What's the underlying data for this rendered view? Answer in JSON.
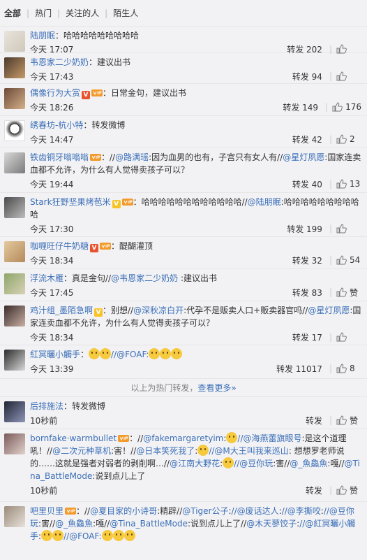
{
  "filters": {
    "all": "全部",
    "hot": "热门",
    "following": "关注的人",
    "strangers": "陌生人"
  },
  "hot_tip": {
    "text": "以上为热门转发，",
    "more": "查看更多»"
  },
  "like_label": "赞",
  "comments": [
    {
      "name": "陆朋眠",
      "text": "：哈哈哈哈哈哈哈哈哈",
      "time": "今天 17:07",
      "repost": "转发 202",
      "likes": ""
    },
    {
      "name": "韦恩家二少奶奶",
      "text": "：建议出书",
      "time": "今天 17:43",
      "repost": "转发 94",
      "likes": ""
    },
    {
      "name": "偶像行为大赏",
      "text": "：日常金句，建议出书",
      "time": "今天 18:26",
      "repost": "转发 149",
      "likes": "176"
    },
    {
      "name": "绣春坊-杭小特",
      "text": "：转发微博",
      "time": "今天 14:47",
      "repost": "转发 42",
      "likes": "2"
    },
    {
      "name": "铁齿铜牙嗡嗡嗡",
      "text_pre": "：//",
      "mention1": "@路满瑶",
      "text_mid": ":因为血男的也有，子宫只有女人有//",
      "mention2": "@星灯夙愿",
      "text_post": ":国家连卖血都不允许，为什么有人觉得卖孩子可以？",
      "time": "今天 19:44",
      "repost": "转发 40",
      "likes": "13"
    },
    {
      "name": "Stark狂野坚果烤苞米",
      "text_pre": "：哈哈哈哈哈哈哈哈哈哈哈哈//",
      "mention1": "@陆朋眠",
      "text_post": ":哈哈哈哈哈哈哈哈哈哈",
      "time": "今天 17:30",
      "repost": "转发 199",
      "likes": ""
    },
    {
      "name": "咖喱旺仔牛奶糖",
      "text": "：醍醐灌顶",
      "time": "今天 18:34",
      "repost": "转发 32",
      "likes": "54"
    },
    {
      "name": "浮流木雁",
      "text_pre": "：真是金句//",
      "mention1": "@韦恩家二少奶奶",
      "text_post": " :建议出书",
      "time": "今天 17:45",
      "repost": "转发 83",
      "likes": "赞"
    },
    {
      "name": "鸡汁组_墨陌急啊",
      "text_pre": "：别想//",
      "mention1": "@深秋凉白开",
      "text_mid": ":代孕不是贩卖人口+贩卖器官吗//",
      "mention2": "@星灯夙愿",
      "text_post": ":国家连卖血都不允许，为什么有人觉得卖孩子可以？",
      "time": "今天 18:34",
      "repost": "转发 17",
      "likes": ""
    },
    {
      "name": "紅冥曬小觸手",
      "text_pre": "：",
      "mention1": "//@FOAF:",
      "time": "今天 13:39",
      "repost": "转发 11017",
      "likes": "8"
    },
    {
      "name": "后排施法",
      "text": "：转发微博",
      "time": "10秒前",
      "repost": "转发",
      "likes": ""
    },
    {
      "name": "bornfake·warmbullet",
      "text_a": "：//",
      "m_a": "@fakemargaretyim",
      "text_b": ":",
      "m_b": "//@海燕蕾旗眼号",
      "text_c": ":是这个道理吼！//",
      "m_c": "@二次元种草机",
      "text_d": ":害！//",
      "m_d": "@日本笑死我了",
      "text_e": ":",
      "m_e": "//@M大王叫我来巡山",
      "text_f": ": 想想罗老师说的……这就是强者对弱者的剥削啊…//",
      "m_f": "@江南大野花",
      "text_g": ":",
      "m_g": "//@豆你玩",
      "text_h": ":害//",
      "m_h": "@_魚鱻魚",
      "text_i": ":嘎//",
      "m_i": "@Tina_BattleMode",
      "text_j": ":说到点儿上了",
      "time": "10秒前",
      "repost": "转发",
      "likes": ""
    },
    {
      "name": "吧里贝里",
      "text_a": "：//",
      "m_a": "@夏目家的小诗哥",
      "text_b": ":精辟//",
      "m_b": "@Tiger公子",
      "text_c": ":",
      "m_c": "//@废话达人",
      "text_d": ":",
      "m_d": "//@李撕咬",
      "text_e": ":",
      "m_e": "//@豆你玩",
      "text_f": ":害//",
      "m_f": "@_魚鱻魚",
      "text_g": ":嘎//",
      "m_g": "@Tina_BattleMode",
      "text_h": ":说到点儿上了//",
      "m_h": "@木天蓼饺子",
      "text_i": ":",
      "m_i": "//@紅冥曬小觸手",
      "text_j": ":",
      "m_j": "//@FOAF:"
    }
  ]
}
